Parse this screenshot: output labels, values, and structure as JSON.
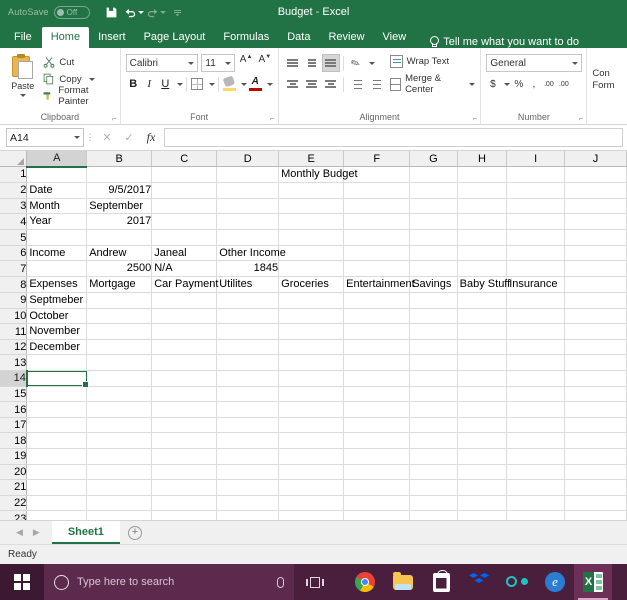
{
  "titlebar": {
    "autosave_label": "AutoSave",
    "autosave_state": "Off",
    "save_icon": "save-icon",
    "undo_icon": "undo-icon",
    "redo_icon": "redo-icon",
    "customize_icon": "customize-quick-access-icon",
    "document_name": "Budget",
    "separator": "-",
    "app_name": "Excel"
  },
  "ribbon_tabs": [
    {
      "label": "File",
      "active": false
    },
    {
      "label": "Home",
      "active": true
    },
    {
      "label": "Insert",
      "active": false
    },
    {
      "label": "Page Layout",
      "active": false
    },
    {
      "label": "Formulas",
      "active": false
    },
    {
      "label": "Data",
      "active": false
    },
    {
      "label": "Review",
      "active": false
    },
    {
      "label": "View",
      "active": false
    }
  ],
  "tell_me": {
    "icon": "lightbulb-icon",
    "label": "Tell me what you want to do"
  },
  "ribbon": {
    "clipboard": {
      "title": "Clipboard",
      "paste_label": "Paste",
      "cut_label": "Cut",
      "copy_label": "Copy",
      "format_painter_label": "Format Painter"
    },
    "font": {
      "title": "Font",
      "font_name": "Calibri",
      "font_size": "11",
      "grow_label": "A",
      "shrink_label": "A",
      "bold_label": "B",
      "italic_label": "I",
      "underline_label": "U"
    },
    "alignment": {
      "title": "Alignment",
      "wrap_text_label": "Wrap Text",
      "merge_center_label": "Merge & Center"
    },
    "number": {
      "title": "Number",
      "format_value": "General",
      "currency_label": "$",
      "percent_label": "%",
      "comma_label": ",",
      "increase_decimal_label": ".00",
      "decrease_decimal_label": ".00"
    },
    "styles": {
      "conditional_line1": "Con",
      "conditional_line2": "Form"
    }
  },
  "formula_bar": {
    "name_box_value": "A14",
    "cancel_icon": "cancel-icon",
    "enter_icon": "confirm-checkmark-icon",
    "function_icon": "insert-function-fx-icon",
    "formula_value": ""
  },
  "grid": {
    "columns": [
      "A",
      "B",
      "C",
      "D",
      "E",
      "F",
      "G",
      "H",
      "I",
      "J"
    ],
    "active_column": "A",
    "active_row": 14,
    "selected_cell": "A14",
    "rows": [
      {
        "n": 1,
        "cells": {
          "E": "Monthly Budget"
        }
      },
      {
        "n": 2,
        "cells": {
          "A": "Date",
          "B": "9/5/2017"
        },
        "num": [
          "B"
        ]
      },
      {
        "n": 3,
        "cells": {
          "A": "Month",
          "B": "September"
        }
      },
      {
        "n": 4,
        "cells": {
          "A": "Year",
          "B": "2017"
        },
        "num": [
          "B"
        ]
      },
      {
        "n": 5,
        "cells": {}
      },
      {
        "n": 6,
        "cells": {
          "A": "Income",
          "B": "Andrew",
          "C": "Janeal",
          "D": "Other Income"
        }
      },
      {
        "n": 7,
        "cells": {
          "B": "2500",
          "C": "N/A",
          "D": "1845"
        },
        "num": [
          "B",
          "D"
        ]
      },
      {
        "n": 8,
        "cells": {
          "A": "Expenses",
          "B": "Mortgage",
          "C": "Car Payment",
          "D": "Utilites",
          "E": "Groceries",
          "F": "Entertainment",
          "G": "Savings",
          "H": "Baby Stuff",
          "I": "Insurance"
        }
      },
      {
        "n": 9,
        "cells": {
          "A": "Septmeber"
        }
      },
      {
        "n": 10,
        "cells": {
          "A": "October"
        }
      },
      {
        "n": 11,
        "cells": {
          "A": "November"
        }
      },
      {
        "n": 12,
        "cells": {
          "A": "December"
        }
      },
      {
        "n": 13,
        "cells": {}
      },
      {
        "n": 14,
        "cells": {}
      },
      {
        "n": 15,
        "cells": {}
      },
      {
        "n": 16,
        "cells": {}
      },
      {
        "n": 17,
        "cells": {}
      },
      {
        "n": 18,
        "cells": {}
      },
      {
        "n": 19,
        "cells": {}
      },
      {
        "n": 20,
        "cells": {}
      },
      {
        "n": 21,
        "cells": {}
      },
      {
        "n": 22,
        "cells": {}
      },
      {
        "n": 23,
        "cells": {}
      }
    ]
  },
  "sheet_bar": {
    "prev_icon": "prev-sheet-arrow-icon",
    "next_icon": "next-sheet-arrow-icon",
    "tabs": [
      {
        "label": "Sheet1",
        "active": true
      }
    ],
    "add_sheet_label": "+"
  },
  "status_bar": {
    "status_text": "Ready"
  },
  "taskbar": {
    "start_icon": "windows-start-icon",
    "search_placeholder": "Type here to search",
    "search_icon": "search-circle-icon",
    "mic_icon": "microphone-icon",
    "task_view_icon": "task-view-icon",
    "apps": [
      {
        "name": "chrome",
        "active": false
      },
      {
        "name": "file-explorer",
        "active": false
      },
      {
        "name": "microsoft-store",
        "active": false
      },
      {
        "name": "dropbox",
        "active": false
      },
      {
        "name": "link-app",
        "active": false
      },
      {
        "name": "microsoft-edge",
        "active": false
      },
      {
        "name": "excel",
        "active": true
      }
    ]
  },
  "colors": {
    "excel_green": "#217346",
    "taskbar": "#4a1f3d",
    "grid_line": "#dcdcdc"
  }
}
